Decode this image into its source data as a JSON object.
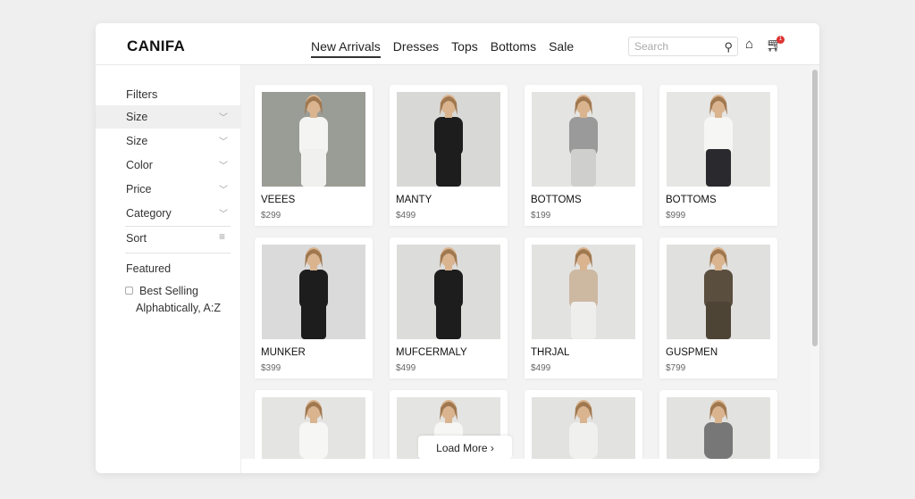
{
  "header": {
    "logo": "CANIFA",
    "nav": [
      "New Arrivals",
      "Dresses",
      "Tops",
      "Bottoms",
      "Sale"
    ],
    "active_nav": "New Arrivals",
    "search_placeholder": "Search",
    "cart_count": "1"
  },
  "sidebar": {
    "title": "Filters",
    "filters": [
      "Size",
      "Size",
      "Color",
      "Price",
      "Category"
    ],
    "sort_label": "Sort",
    "sort_options": {
      "featured": "Featured",
      "best_selling": "Best Selling",
      "alpha": "Alphabtically, A:Z"
    }
  },
  "products": [
    {
      "name": "VEEES",
      "price": "$299",
      "top": "#f4f4f2",
      "bottom": "#f0f0ee",
      "bg": "#9a9c96"
    },
    {
      "name": "MANTY",
      "price": "$499",
      "top": "#1d1d1d",
      "bottom": "#1d1d1d",
      "bg": "#d8d8d6"
    },
    {
      "name": "BOTTOMS",
      "price": "$199",
      "top": "#9a9a9a",
      "bottom": "#cfcfcd",
      "bg": "#e4e4e2"
    },
    {
      "name": "BOTTOMS",
      "price": "$999",
      "top": "#f6f6f4",
      "bottom": "#2a2a2e",
      "bg": "#e6e6e4"
    },
    {
      "name": "MUNKER",
      "price": "$399",
      "top": "#1d1d1d",
      "bottom": "#1d1d1d",
      "bg": "#dadada"
    },
    {
      "name": "MUFCERMALY",
      "price": "$499",
      "top": "#1d1d1d",
      "bottom": "#1d1d1d",
      "bg": "#dcdcda"
    },
    {
      "name": "THRJAL",
      "price": "$499",
      "top": "#cdb8a2",
      "bottom": "#eeeeec",
      "bg": "#e2e2e0"
    },
    {
      "name": "GUSPMEN",
      "price": "$799",
      "top": "#5a4e3e",
      "bottom": "#4e4436",
      "bg": "#e0e0de"
    },
    {
      "name": "",
      "price": "",
      "top": "#f6f6f4",
      "bottom": "#f6f6f4",
      "bg": "#e4e4e2"
    },
    {
      "name": "",
      "price": "",
      "top": "#f6f6f4",
      "bottom": "#1a1a1a",
      "bg": "#e4e4e2"
    },
    {
      "name": "",
      "price": "",
      "top": "#f0f0ee",
      "bottom": "#f0f0ee",
      "bg": "#e2e2e0"
    },
    {
      "name": "",
      "price": "",
      "top": "#777",
      "bottom": "#777",
      "bg": "#e2e2e0"
    }
  ],
  "load_more": "Load More ›"
}
